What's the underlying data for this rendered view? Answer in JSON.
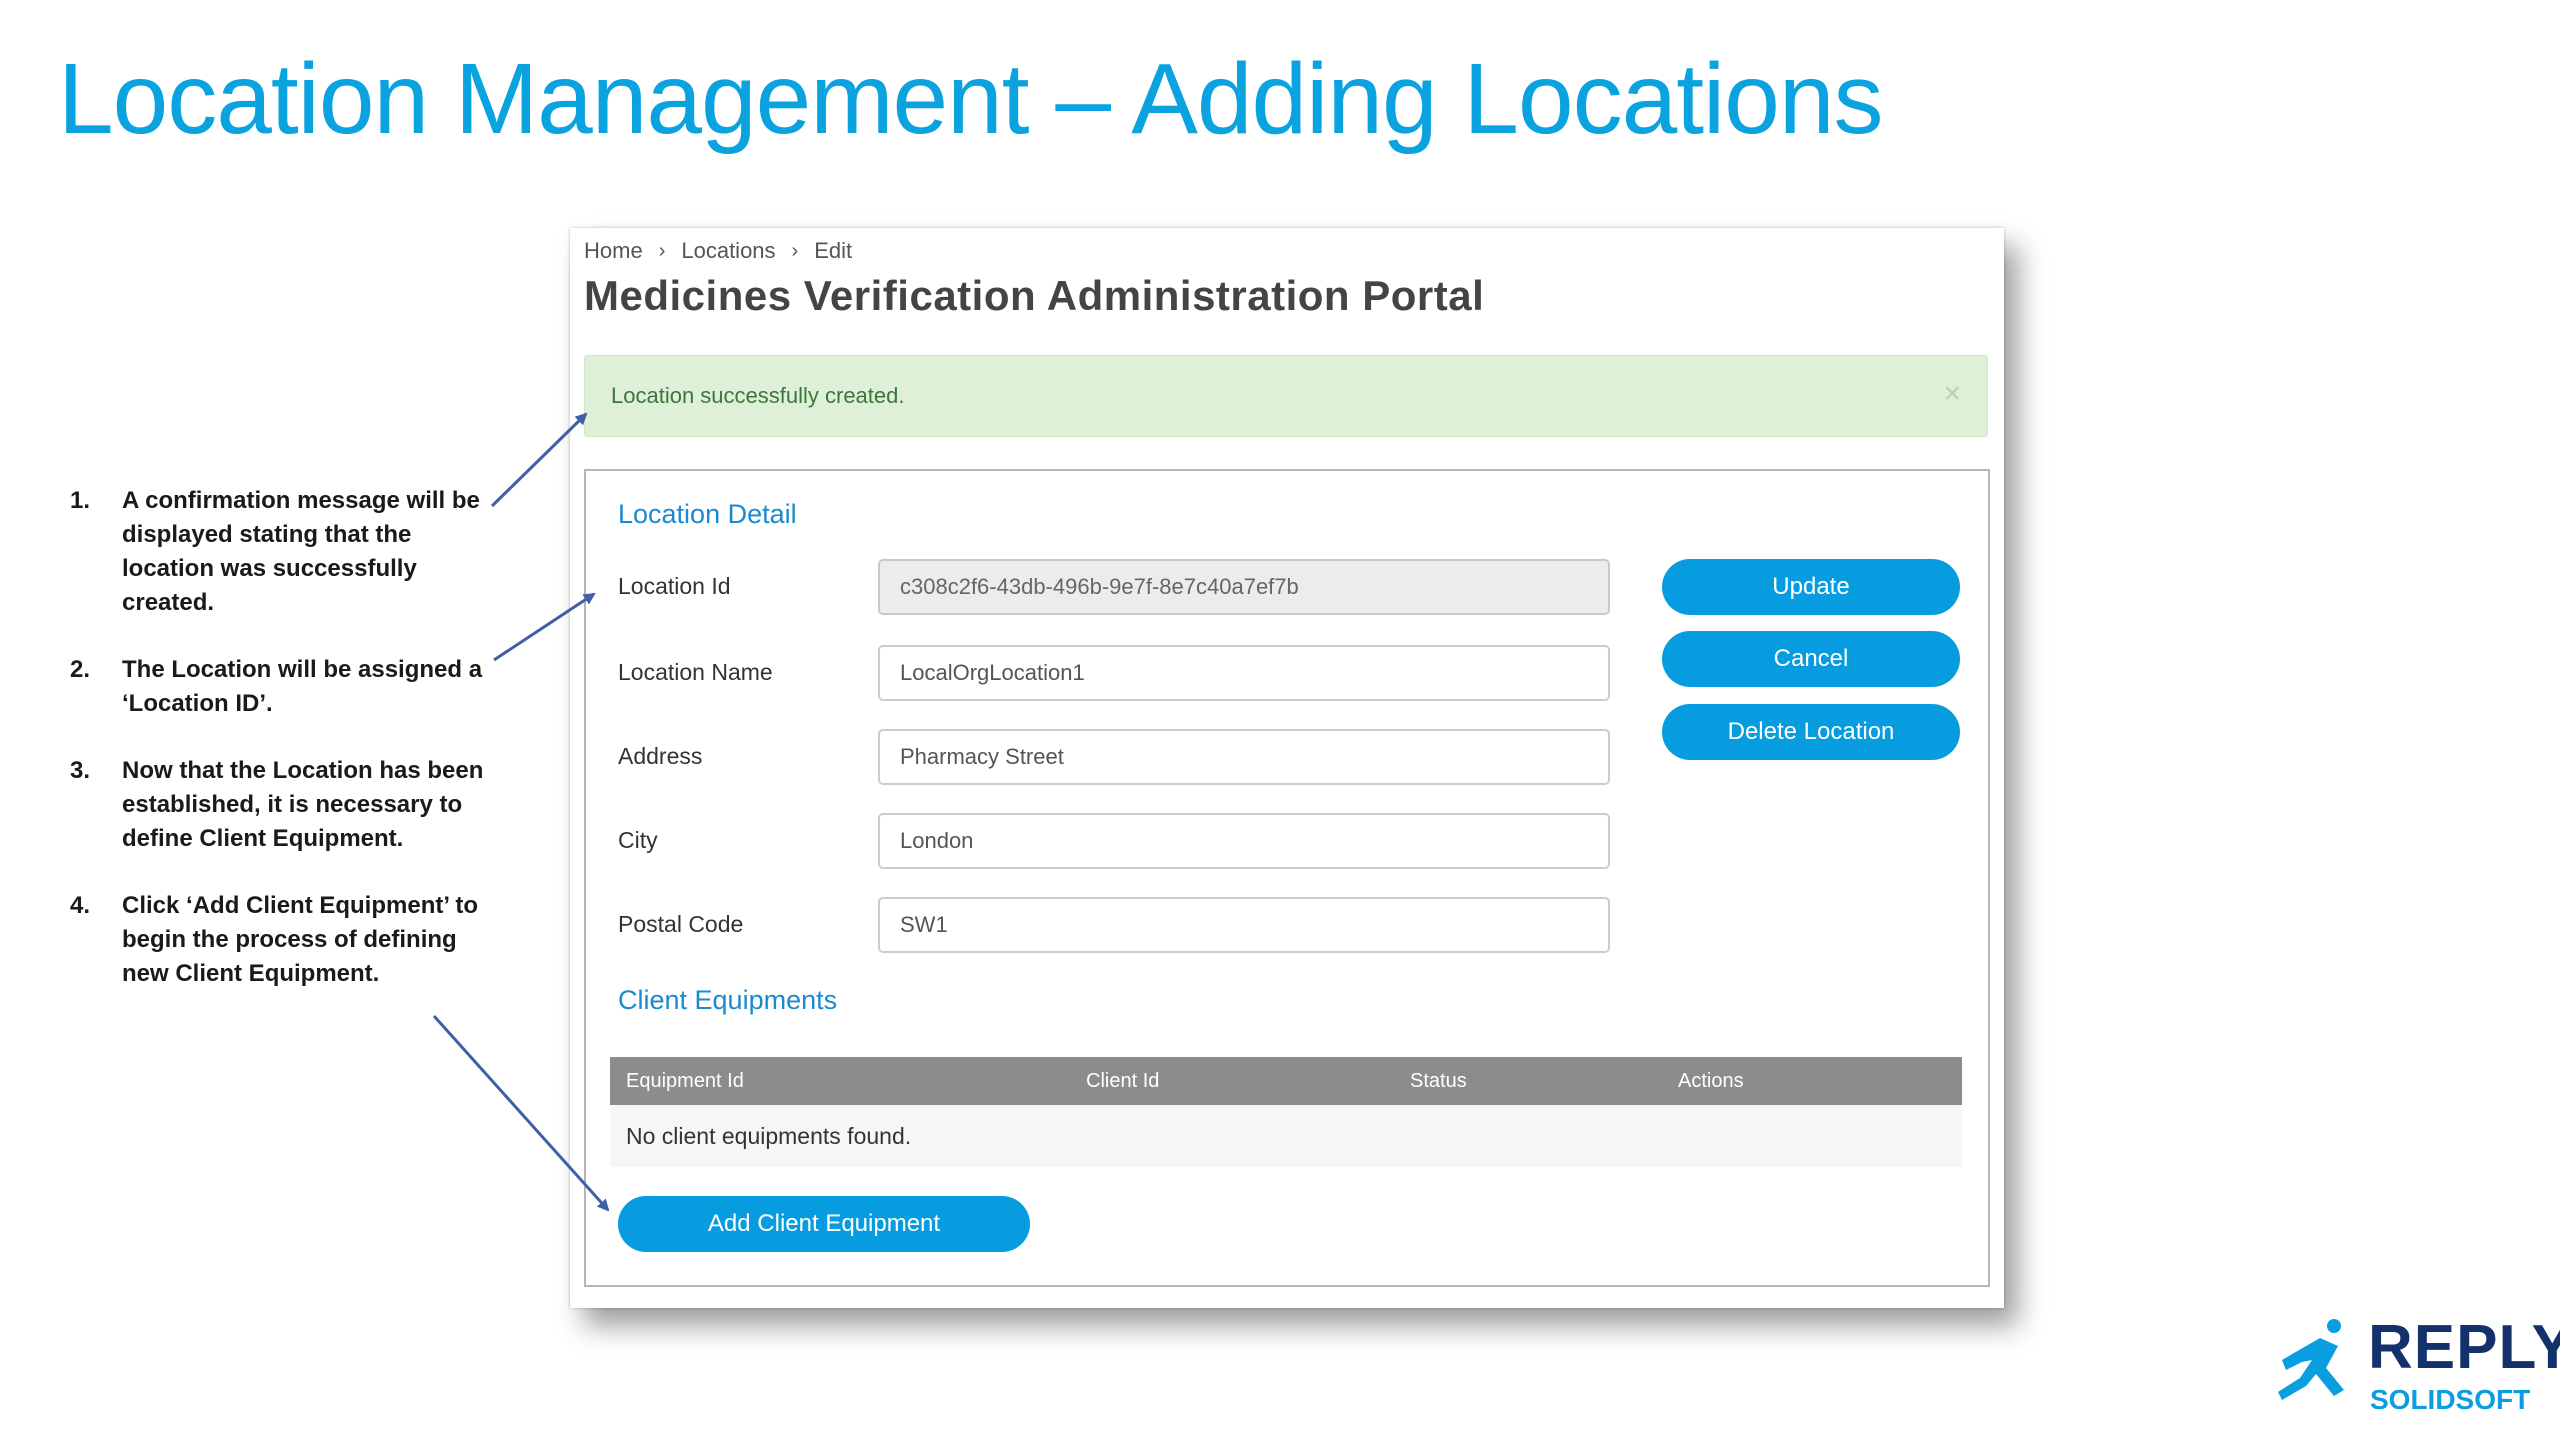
{
  "slide": {
    "title": "Location Management – Adding Locations"
  },
  "steps": [
    {
      "number": "1.",
      "text": "A confirmation message will be displayed stating that the location was successfully created."
    },
    {
      "number": "2.",
      "text": "The Location will be assigned a ‘Location ID’."
    },
    {
      "number": "3.",
      "text": "Now that the Location has been established, it is necessary to define Client Equipment."
    },
    {
      "number": "4.",
      "text": "Click ‘Add Client Equipment’ to begin the process of defining new Client Equipment."
    }
  ],
  "portal": {
    "breadcrumb": [
      "Home",
      "Locations",
      "Edit"
    ],
    "breadcrumb_separator": "›",
    "title": "Medicines Verification Administration Portal",
    "alert": {
      "message": "Location successfully created.",
      "close": "×"
    },
    "location_detail": {
      "title": "Location Detail",
      "fields": [
        {
          "label": "Location Id",
          "value": "c308c2f6-43db-496b-9e7f-8e7c40a7ef7b",
          "readonly": true
        },
        {
          "label": "Location Name",
          "value": "LocalOrgLocation1"
        },
        {
          "label": "Address",
          "value": "Pharmacy Street"
        },
        {
          "label": "City",
          "value": "London"
        },
        {
          "label": "Postal Code",
          "value": "SW1"
        }
      ],
      "buttons": [
        "Update",
        "Cancel",
        "Delete Location"
      ]
    },
    "client_equipments": {
      "title": "Client Equipments",
      "columns": [
        "Equipment Id",
        "Client Id",
        "Status",
        "Actions"
      ],
      "empty_message": "No client equipments found.",
      "add_button": "Add Client Equipment"
    }
  },
  "logo": {
    "name": "REPLY",
    "sub": "SOLIDSOFT"
  },
  "colors": {
    "title_blue": "#0aa3e0",
    "button_blue": "#079ce0",
    "section_blue": "#1a8ad0",
    "alert_green_bg": "#dff0d8",
    "alert_green_text": "#3c763d",
    "table_header": "#8c8c8c",
    "logo_navy": "#13326b",
    "arrow": "#3f5fa8"
  }
}
